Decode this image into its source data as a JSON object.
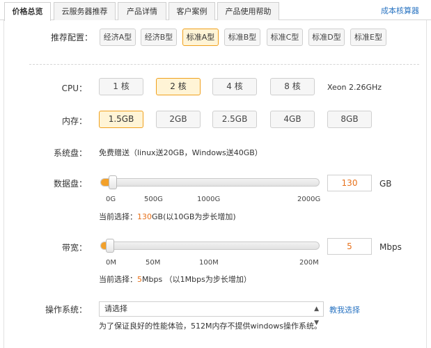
{
  "tabs": [
    {
      "label": "价格总览",
      "active": true
    },
    {
      "label": "云服务器推荐",
      "active": false
    },
    {
      "label": "产品详情",
      "active": false
    },
    {
      "label": "客户案例",
      "active": false
    },
    {
      "label": "产品使用帮助",
      "active": false
    }
  ],
  "calc_link": "成本核算器",
  "recommend": {
    "label": "推荐配置：",
    "options": [
      "经济A型",
      "经济B型",
      "标准A型",
      "标准B型",
      "标准C型",
      "标准D型",
      "标准E型"
    ],
    "selected": "标准A型"
  },
  "cpu": {
    "label": "CPU：",
    "options": [
      "1 核",
      "2 核",
      "4 核",
      "8 核"
    ],
    "selected": "2 核",
    "note": "Xeon 2.26GHz"
  },
  "memory": {
    "label": "内存：",
    "options": [
      "1.5GB",
      "2GB",
      "2.5GB",
      "4GB",
      "8GB"
    ],
    "selected": "1.5GB"
  },
  "system_disk": {
    "label": "系统盘：",
    "text": "免费赠送（linux送20GB，Windows送40GB）"
  },
  "data_disk": {
    "label": "数据盘：",
    "value": "130",
    "unit": "GB",
    "min": 0,
    "max": 2000,
    "ticks": [
      "0G",
      "500G",
      "1000G",
      "2000G"
    ],
    "note_prefix": "当前选择：",
    "note_value": "130",
    "note_suffix": "GB(以10GB为步长增加)"
  },
  "bandwidth": {
    "label": "带宽：",
    "value": "5",
    "unit": "Mbps",
    "min": 0,
    "max": 200,
    "ticks": [
      "0M",
      "50M",
      "100M",
      "200M"
    ],
    "note_prefix": "当前选择：",
    "note_value": "5",
    "note_suffix": "Mbps （以1Mbps为步长增加）"
  },
  "os": {
    "label": "操作系统：",
    "placeholder": "请选择",
    "help_link": "教我选择",
    "note": "为了保证良好的性能体验，512M内存不提供windows操作系统。"
  },
  "colors": {
    "accent": "#f3a12a",
    "link": "#2a74c2",
    "selected_bg": "#fff4d6"
  }
}
